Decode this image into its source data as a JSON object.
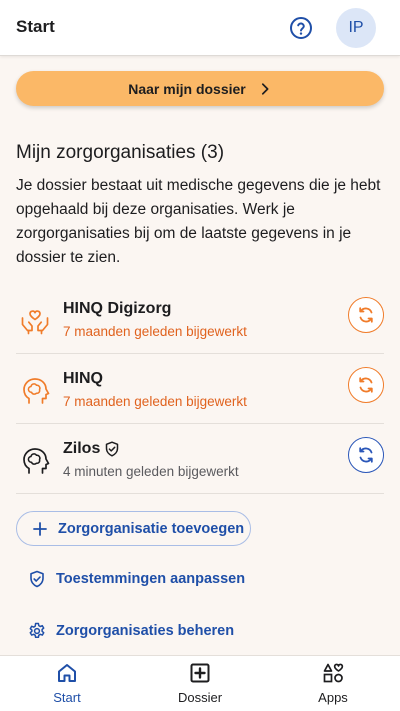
{
  "header": {
    "title": "Start",
    "help_icon": "help-circle-icon",
    "avatar_initials": "IP"
  },
  "dossier_button": {
    "label": "Naar mijn dossier",
    "icon": "chevron-right-icon"
  },
  "organizations": {
    "title": "Mijn zorgorganisaties (3)",
    "intro": "Je dossier bestaat uit medische gegevens die je hebt opgehaald bij deze organisaties. Werk je zorgorganisaties bij om de laatste gegevens in je dossier te zien.",
    "items": [
      {
        "name": "HINQ Digizorg",
        "status": "7 maanden geleden bijgewerkt",
        "icon": "care-hands-icon",
        "verified": false,
        "stale": true
      },
      {
        "name": "HINQ",
        "status": "7 maanden geleden bijgewerkt",
        "icon": "head-profile-icon",
        "verified": false,
        "stale": true
      },
      {
        "name": "Zilos",
        "status": "4 minuten geleden bijgewerkt",
        "icon": "head-profile-icon",
        "verified": true,
        "stale": false
      }
    ]
  },
  "actions": {
    "add_label": "Zorgorganisatie toevoegen",
    "permissions_label": "Toestemmingen aanpassen",
    "manage_label": "Zorgorganisaties beheren"
  },
  "bottom_nav": {
    "items": [
      {
        "label": "Start",
        "icon": "home-icon",
        "active": true
      },
      {
        "label": "Dossier",
        "icon": "medical-plus-icon",
        "active": false
      },
      {
        "label": "Apps",
        "icon": "apps-shapes-icon",
        "active": false
      }
    ]
  },
  "colors": {
    "primary": "#1f4fa8",
    "accent_orange": "#f07c2a",
    "button_orange": "#fbb867",
    "background": "#fbf6f2"
  }
}
